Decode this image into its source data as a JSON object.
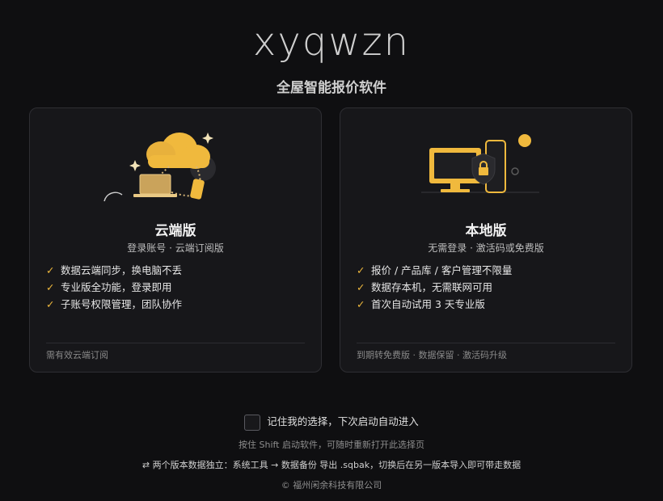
{
  "brand": {
    "logo_text": "xyqwzn",
    "subtitle": "全屋智能报价软件"
  },
  "cards": [
    {
      "title": "云端版",
      "subtitle": "登录账号 · 云端订阅版",
      "features": [
        "数据云端同步，换电脑不丢",
        "专业版全功能，登录即用",
        "子账号权限管理，团队协作"
      ],
      "footnote": "需有效云端订阅",
      "illustration": "cloud-icon"
    },
    {
      "title": "本地版",
      "subtitle": "无需登录 · 激活码或免费版",
      "features": [
        "报价 / 产品库 / 客户管理不限量",
        "数据存本机，无需联网可用",
        "首次自动试用 3 天专业版"
      ],
      "footnote": "到期转免费版 · 数据保留 · 激活码升级",
      "illustration": "desktop-lock-icon"
    }
  ],
  "check_symbol": "✓",
  "remember": {
    "label": "记住我的选择，下次启动自动进入",
    "checked": false
  },
  "hint": "按住 Shift 启动软件，可随时重新打开此选择页",
  "note": "⇄  两个版本数据独立：系统工具 → 数据备份 导出 .sqbak，切换后在另一版本导入即可带走数据",
  "copyright": "© 福州闲余科技有限公司",
  "colors": {
    "accent": "#f0b93d",
    "background": "#0f0f11",
    "card": "#17171a"
  }
}
